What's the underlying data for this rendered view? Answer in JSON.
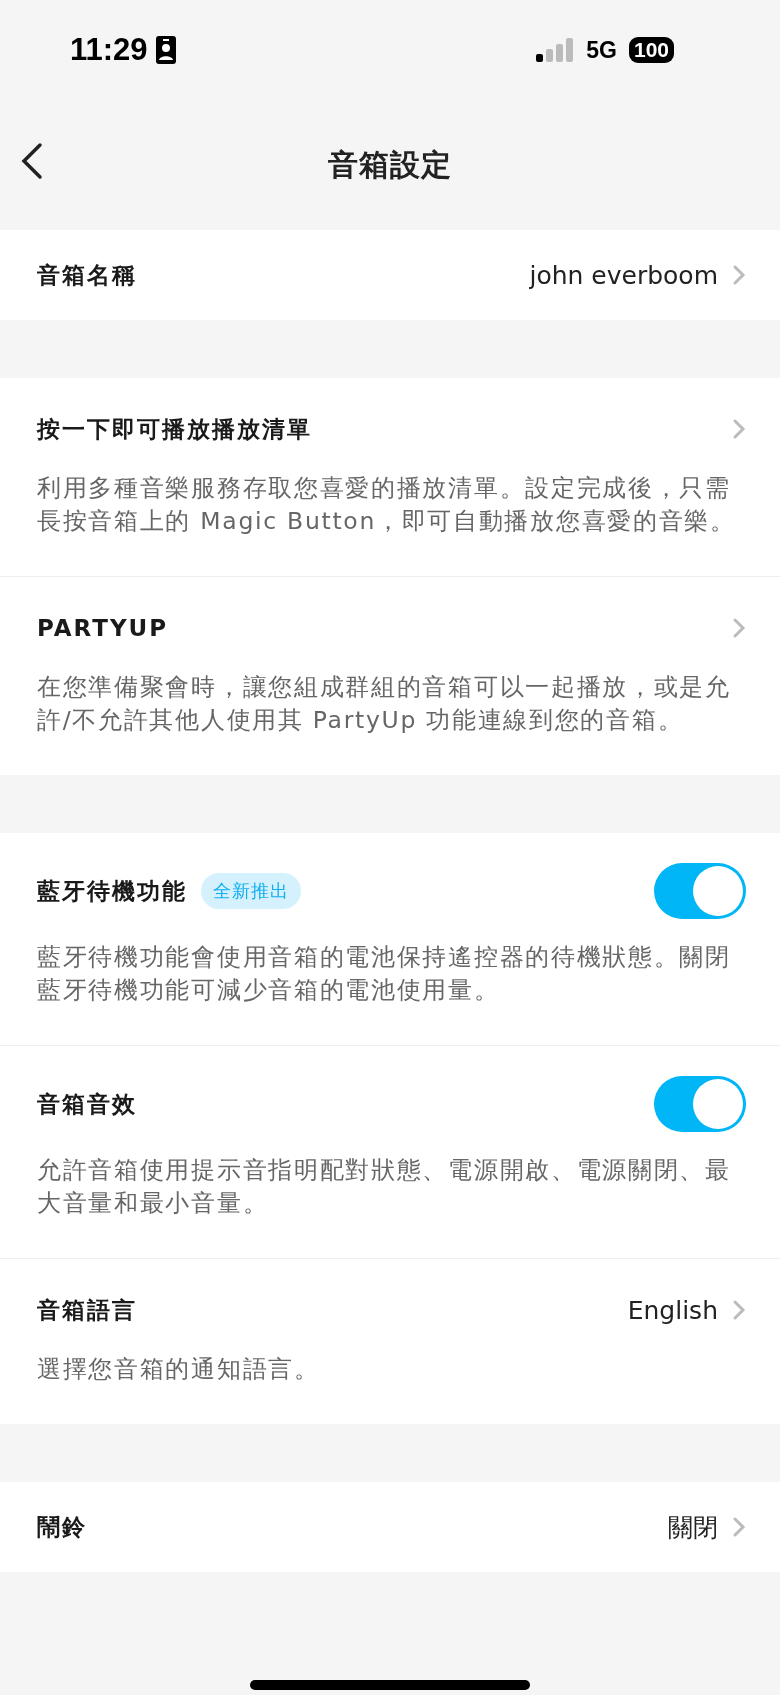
{
  "status_bar": {
    "time": "11:29",
    "network": "5G",
    "battery": "100"
  },
  "nav": {
    "title": "音箱設定"
  },
  "groups": [
    {
      "items": [
        {
          "kind": "link",
          "title": "音箱名稱",
          "value": "john everboom"
        }
      ]
    },
    {
      "items": [
        {
          "kind": "link",
          "title": "按一下即可播放播放清單",
          "description": "利用多種音樂服務存取您喜愛的播放清單。設定完成後，只需長按音箱上的 Magic Button，即可自動播放您喜愛的音樂。"
        },
        {
          "kind": "link",
          "title": "PARTYUP",
          "description": "在您準備聚會時，讓您組成群組的音箱可以一起播放，或是允許/不允許其他人使用其 PartyUp 功能連線到您的音箱。"
        }
      ]
    },
    {
      "items": [
        {
          "kind": "toggle",
          "title": "藍牙待機功能",
          "badge": "全新推出",
          "on": true,
          "description": "藍牙待機功能會使用音箱的電池保持遙控器的待機狀態。關閉藍牙待機功能可減少音箱的電池使用量。"
        },
        {
          "kind": "toggle",
          "title": "音箱音效",
          "on": true,
          "description": "允許音箱使用提示音指明配對狀態、電源開啟、電源關閉、最大音量和最小音量。"
        },
        {
          "kind": "link",
          "title": "音箱語言",
          "value": "English",
          "description": "選擇您音箱的通知語言。"
        }
      ]
    },
    {
      "items": [
        {
          "kind": "link",
          "title": "鬧鈴",
          "value": "關閉"
        }
      ]
    }
  ]
}
